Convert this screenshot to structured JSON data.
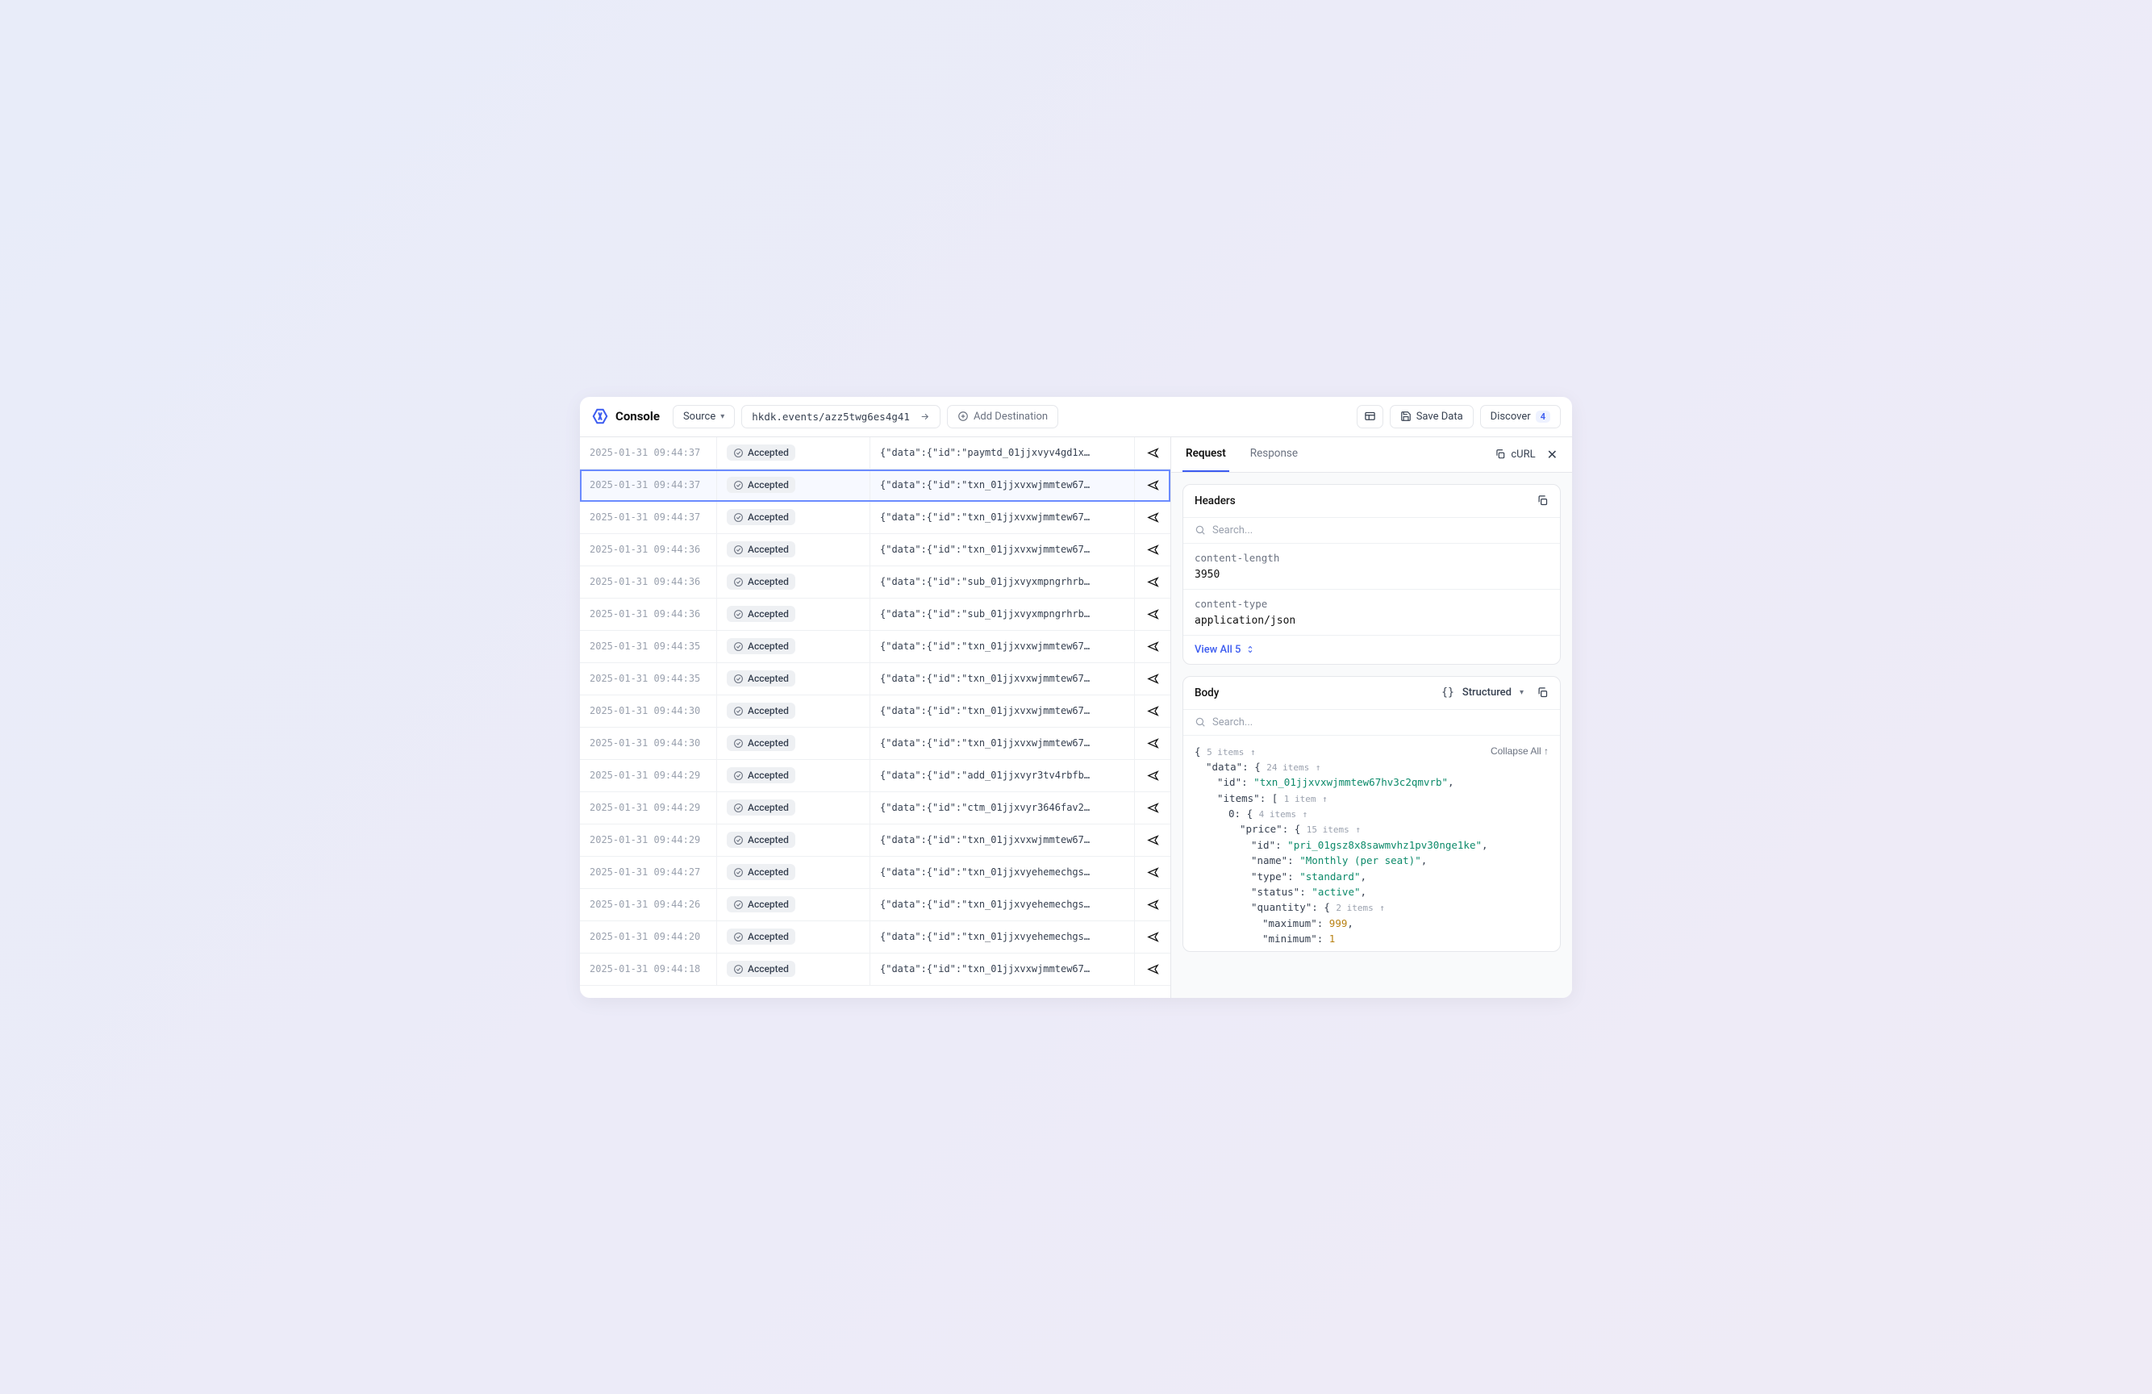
{
  "brand": "Console",
  "toolbar": {
    "source_label": "Source",
    "url": "hkdk.events/azz5twg6es4g41",
    "add_destination": "Add Destination",
    "save_data": "Save Data",
    "discover": "Discover",
    "discover_count": "4"
  },
  "events": [
    {
      "ts": "2025-01-31 09:44:37",
      "status": "Accepted",
      "payload": "{\"data\":{\"id\":\"paymtd_01jjxvyv4gd1x…"
    },
    {
      "ts": "2025-01-31 09:44:37",
      "status": "Accepted",
      "payload": "{\"data\":{\"id\":\"txn_01jjxvxwjmmtew67…",
      "selected": true
    },
    {
      "ts": "2025-01-31 09:44:37",
      "status": "Accepted",
      "payload": "{\"data\":{\"id\":\"txn_01jjxvxwjmmtew67…"
    },
    {
      "ts": "2025-01-31 09:44:36",
      "status": "Accepted",
      "payload": "{\"data\":{\"id\":\"txn_01jjxvxwjmmtew67…"
    },
    {
      "ts": "2025-01-31 09:44:36",
      "status": "Accepted",
      "payload": "{\"data\":{\"id\":\"sub_01jjxvyxmpngrhrb…"
    },
    {
      "ts": "2025-01-31 09:44:36",
      "status": "Accepted",
      "payload": "{\"data\":{\"id\":\"sub_01jjxvyxmpngrhrb…"
    },
    {
      "ts": "2025-01-31 09:44:35",
      "status": "Accepted",
      "payload": "{\"data\":{\"id\":\"txn_01jjxvxwjmmtew67…"
    },
    {
      "ts": "2025-01-31 09:44:35",
      "status": "Accepted",
      "payload": "{\"data\":{\"id\":\"txn_01jjxvxwjmmtew67…"
    },
    {
      "ts": "2025-01-31 09:44:30",
      "status": "Accepted",
      "payload": "{\"data\":{\"id\":\"txn_01jjxvxwjmmtew67…"
    },
    {
      "ts": "2025-01-31 09:44:30",
      "status": "Accepted",
      "payload": "{\"data\":{\"id\":\"txn_01jjxvxwjmmtew67…"
    },
    {
      "ts": "2025-01-31 09:44:29",
      "status": "Accepted",
      "payload": "{\"data\":{\"id\":\"add_01jjxvyr3tv4rbfb…"
    },
    {
      "ts": "2025-01-31 09:44:29",
      "status": "Accepted",
      "payload": "{\"data\":{\"id\":\"ctm_01jjxvyr3646fav2…"
    },
    {
      "ts": "2025-01-31 09:44:29",
      "status": "Accepted",
      "payload": "{\"data\":{\"id\":\"txn_01jjxvxwjmmtew67…"
    },
    {
      "ts": "2025-01-31 09:44:27",
      "status": "Accepted",
      "payload": "{\"data\":{\"id\":\"txn_01jjxvyehemechgs…"
    },
    {
      "ts": "2025-01-31 09:44:26",
      "status": "Accepted",
      "payload": "{\"data\":{\"id\":\"txn_01jjxvyehemechgs…"
    },
    {
      "ts": "2025-01-31 09:44:20",
      "status": "Accepted",
      "payload": "{\"data\":{\"id\":\"txn_01jjxvyehemechgs…"
    },
    {
      "ts": "2025-01-31 09:44:18",
      "status": "Accepted",
      "payload": "{\"data\":{\"id\":\"txn_01jjxvxwjmmtew67…"
    }
  ],
  "detail": {
    "tabs": {
      "request": "Request",
      "response": "Response"
    },
    "curl_label": "cURL",
    "headers": {
      "title": "Headers",
      "search_placeholder": "Search...",
      "items": [
        {
          "key": "content-length",
          "value": "3950"
        },
        {
          "key": "content-type",
          "value": "application/json"
        }
      ],
      "view_all": "View All 5"
    },
    "body": {
      "title": "Body",
      "view_mode": "Structured",
      "search_placeholder": "Search...",
      "collapse_all": "Collapse All",
      "summary_root": "5 items",
      "summary_data": "24 items",
      "summary_items": "1 item",
      "summary_zero": "4 items",
      "summary_price": "15 items",
      "summary_quantity": "2 items",
      "json": {
        "data_id": "txn_01jjxvxwjmmtew67hv3c2qmvrb",
        "price_id": "pri_01gsz8x8sawmvhz1pv30nge1ke",
        "price_name": "Monthly (per seat)",
        "price_type": "standard",
        "price_status": "active",
        "qty_max": 999,
        "qty_min": 1
      }
    }
  }
}
